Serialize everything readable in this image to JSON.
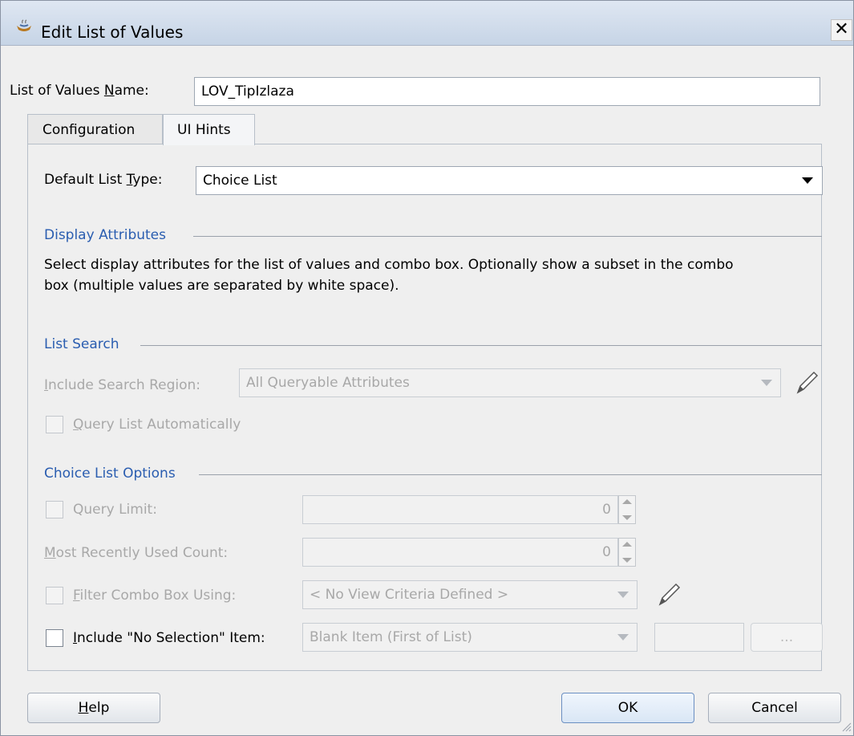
{
  "window": {
    "title": "Edit List of Values"
  },
  "lov_name": {
    "label_prefix": "List of Values ",
    "label_mnemonic": "N",
    "label_suffix": "ame:",
    "value": "LOV_TipIzlaza"
  },
  "tabs": [
    {
      "label": "Configuration",
      "active": false
    },
    {
      "label": "UI Hints",
      "active": true
    }
  ],
  "default_list_type": {
    "label_prefix": "Default List ",
    "label_mnemonic": "T",
    "label_suffix": "ype:",
    "value": "Choice List"
  },
  "display_attributes": {
    "heading": "Display Attributes",
    "description_line1": "Select display attributes for the list of values and combo box. Optionally show a subset in the combo",
    "description_line2": "box (multiple values are separated by white space)."
  },
  "list_search": {
    "heading": "List Search",
    "include_region_mnemonic": "I",
    "include_region_rest": "nclude Search Region:",
    "include_region_value": "All Queryable Attributes",
    "query_auto_mnemonic": "Q",
    "query_auto_rest": "uery List Automatically"
  },
  "choice_list_options": {
    "heading": "Choice List Options",
    "query_limit_label": "Query Limit:",
    "query_limit_value": "0",
    "mru_mnemonic": "M",
    "mru_rest": "ost Recently Used Count:",
    "mru_value": "0",
    "filter_mnemonic": "F",
    "filter_rest": "ilter Combo Box Using:",
    "filter_value": "< No View Criteria Defined >",
    "no_selection_mnemonic": "I",
    "no_selection_rest": "nclude \"No Selection\" Item:",
    "no_selection_value": "Blank Item (First of List)",
    "no_selection_text": "",
    "ellipsis": "..."
  },
  "buttons": {
    "help_mnemonic": "H",
    "help_rest": "elp",
    "ok": "OK",
    "cancel": "Cancel"
  }
}
